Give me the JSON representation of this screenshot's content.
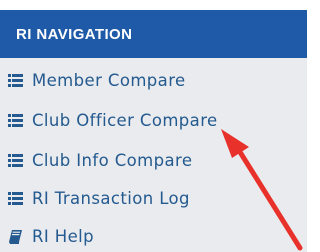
{
  "header": {
    "title": "RI NAVIGATION"
  },
  "nav": {
    "items": [
      {
        "label": "Member Compare",
        "icon": "list-icon"
      },
      {
        "label": "Club Officer Compare",
        "icon": "list-icon"
      },
      {
        "label": "Club Info Compare",
        "icon": "list-icon"
      },
      {
        "label": "RI Transaction Log",
        "icon": "list-icon"
      },
      {
        "label": "RI Help",
        "icon": "book-icon"
      }
    ]
  },
  "colors": {
    "header_bg": "#1f5aa8",
    "panel_bg": "#e9ebee",
    "link": "#245a8f",
    "annotation_arrow": "#e8312b"
  }
}
